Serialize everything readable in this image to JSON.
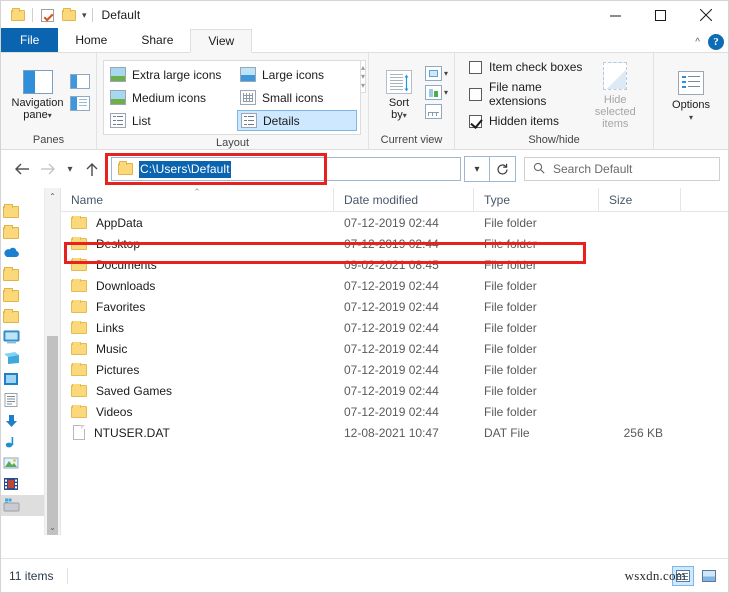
{
  "window": {
    "title": "Default",
    "quick_access": [
      "folder-icon",
      "properties-checkbox-icon",
      "new-folder-icon"
    ],
    "dropdown_caret": "▾",
    "minimize": "minimize-icon",
    "maximize": "maximize-icon",
    "close": "close-icon"
  },
  "tabs": {
    "file": "File",
    "items": [
      {
        "label": "Home",
        "active": false
      },
      {
        "label": "Share",
        "active": false
      },
      {
        "label": "View",
        "active": true
      }
    ],
    "collapse_ribbon": "^",
    "help": "?"
  },
  "ribbon": {
    "groups": [
      {
        "label": "Panes"
      },
      {
        "label": "Layout"
      },
      {
        "label": "Current view"
      },
      {
        "label": "Show/hide"
      }
    ],
    "panes": {
      "navigation_pane": "Navigation\npane",
      "navigation_pane_line1": "Navigation",
      "navigation_pane_line2": "pane",
      "caret": "▾"
    },
    "layout": {
      "options": [
        {
          "label": "Extra large icons",
          "selected": false
        },
        {
          "label": "Large icons",
          "selected": false
        },
        {
          "label": "Medium icons",
          "selected": false
        },
        {
          "label": "Small icons",
          "selected": false
        },
        {
          "label": "List",
          "selected": false
        },
        {
          "label": "Details",
          "selected": true
        }
      ],
      "scroll_up": "▴",
      "scroll_down": "▾",
      "scroll_more": "▾"
    },
    "current_view": {
      "sort_by_line1": "Sort",
      "sort_by_line2": "by",
      "caret": "▾"
    },
    "show_hide": {
      "checkboxes": [
        {
          "label": "Item check boxes",
          "checked": false
        },
        {
          "label": "File name extensions",
          "checked": false
        },
        {
          "label": "Hidden items",
          "checked": true
        }
      ],
      "hide_selected_line1": "Hide selected",
      "hide_selected_line2": "items",
      "options_label": "Options",
      "options_caret": "▾"
    }
  },
  "addressbar": {
    "back": "←",
    "forward": "→",
    "recent": "▾",
    "up": "↑",
    "path": "C:\\Users\\Default",
    "path_selected": true,
    "dropdown": "▾",
    "refresh": "↻",
    "search_placeholder": "Search Default"
  },
  "columns": [
    {
      "key": "name",
      "label": "Name",
      "sorted": true
    },
    {
      "key": "date",
      "label": "Date modified",
      "sorted": false
    },
    {
      "key": "type",
      "label": "Type",
      "sorted": false
    },
    {
      "key": "size",
      "label": "Size",
      "sorted": false
    }
  ],
  "files": [
    {
      "name": "AppData",
      "date": "07-12-2019 02:44",
      "type": "File folder",
      "size": "",
      "icon": "folder",
      "highlighted": false
    },
    {
      "name": "Desktop",
      "date": "07-12-2019 02:44",
      "type": "File folder",
      "size": "",
      "icon": "folder",
      "highlighted": true
    },
    {
      "name": "Documents",
      "date": "09-02-2021 08:45",
      "type": "File folder",
      "size": "",
      "icon": "folder",
      "highlighted": false
    },
    {
      "name": "Downloads",
      "date": "07-12-2019 02:44",
      "type": "File folder",
      "size": "",
      "icon": "folder",
      "highlighted": false
    },
    {
      "name": "Favorites",
      "date": "07-12-2019 02:44",
      "type": "File folder",
      "size": "",
      "icon": "folder",
      "highlighted": false
    },
    {
      "name": "Links",
      "date": "07-12-2019 02:44",
      "type": "File folder",
      "size": "",
      "icon": "folder",
      "highlighted": false
    },
    {
      "name": "Music",
      "date": "07-12-2019 02:44",
      "type": "File folder",
      "size": "",
      "icon": "folder",
      "highlighted": false
    },
    {
      "name": "Pictures",
      "date": "07-12-2019 02:44",
      "type": "File folder",
      "size": "",
      "icon": "folder",
      "highlighted": false
    },
    {
      "name": "Saved Games",
      "date": "07-12-2019 02:44",
      "type": "File folder",
      "size": "",
      "icon": "folder",
      "highlighted": false
    },
    {
      "name": "Videos",
      "date": "07-12-2019 02:44",
      "type": "File folder",
      "size": "",
      "icon": "folder",
      "highlighted": false
    },
    {
      "name": "NTUSER.DAT",
      "date": "12-08-2021 10:47",
      "type": "DAT File",
      "size": "256 KB",
      "icon": "file",
      "highlighted": false
    }
  ],
  "navpane": {
    "scroll_up": "⌃",
    "scroll_down": "⌄",
    "icons": [
      "folder-icon",
      "folder-icon",
      "onedrive-cloud-icon",
      "folder-icon",
      "folder-icon",
      "folder-icon",
      "this-pc-icon",
      "desktop-icon",
      "documents-blue-icon",
      "documents-icon",
      "downloads-icon",
      "music-icon",
      "pictures-icon",
      "videos-icon",
      "local-disk-icon"
    ]
  },
  "statusbar": {
    "item_count": "11 items",
    "view_details": "details-view-icon",
    "view_large": "large-icons-view-icon"
  },
  "watermark": "wsxdn.com",
  "colors": {
    "accent": "#0b64b0",
    "annotation_red": "#e8201e",
    "selection_blue": "#cde8ff",
    "folder_yellow": "#fbd97a"
  }
}
